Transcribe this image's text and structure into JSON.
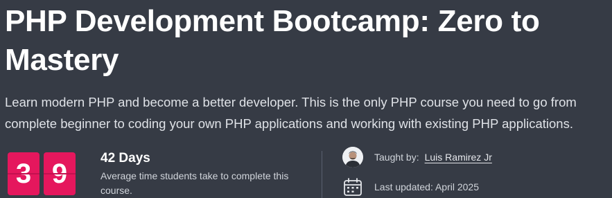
{
  "course": {
    "title": "PHP Development Bootcamp: Zero to Mastery",
    "description": "Learn modern PHP and become a better developer. This is the only PHP course you need to go from complete beginner to coding your own PHP applications and working with existing PHP applications."
  },
  "stats": {
    "counter_digits": [
      "3",
      "9"
    ],
    "duration_value": "42 Days",
    "duration_caption": "Average time students take to complete this course."
  },
  "meta": {
    "taught_by_label": "Taught by:",
    "instructor_name": "Luis Ramirez Jr",
    "last_updated": "Last updated: April 2025"
  },
  "icons": {
    "avatar": "instructor-avatar",
    "calendar": "calendar-icon"
  },
  "colors": {
    "background": "#363b45",
    "counter_accent": "#e5175d"
  }
}
